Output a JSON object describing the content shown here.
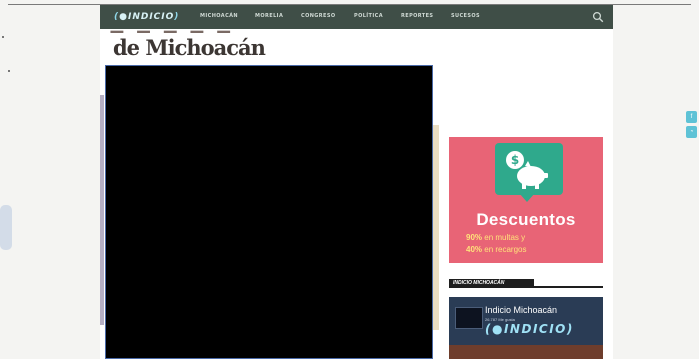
{
  "brand": {
    "logo_text": "INDICIO"
  },
  "nav": {
    "items": [
      "MICHOACÁN",
      "MORELIA",
      "CONGRESO",
      "POLÍTICA",
      "REPORTES",
      "SUCESOS"
    ],
    "search_icon": "search-icon"
  },
  "article": {
    "headline_tail": "de Michoacán"
  },
  "ad": {
    "title": "Descuentos",
    "line1_pct": "90%",
    "line1_text": "en multas y",
    "line2_pct": "40%",
    "line2_text": "en recargos",
    "icon": "piggy-bank-dollar-icon",
    "colors": {
      "background": "#e86476",
      "bubble": "#2fa98c",
      "accent": "#ffe27a"
    }
  },
  "sidebar": {
    "section_title": "INDICIO MICHOACÁN",
    "widget": {
      "name": "Indicio Michoacán",
      "likes": "26.787 Me gusta",
      "logo": "INDICIO"
    }
  },
  "social": {
    "icons": [
      "facebook-icon",
      "rss-icon"
    ]
  },
  "colors": {
    "nav": "#3f4e47",
    "video_border": "#4a6aa8"
  }
}
